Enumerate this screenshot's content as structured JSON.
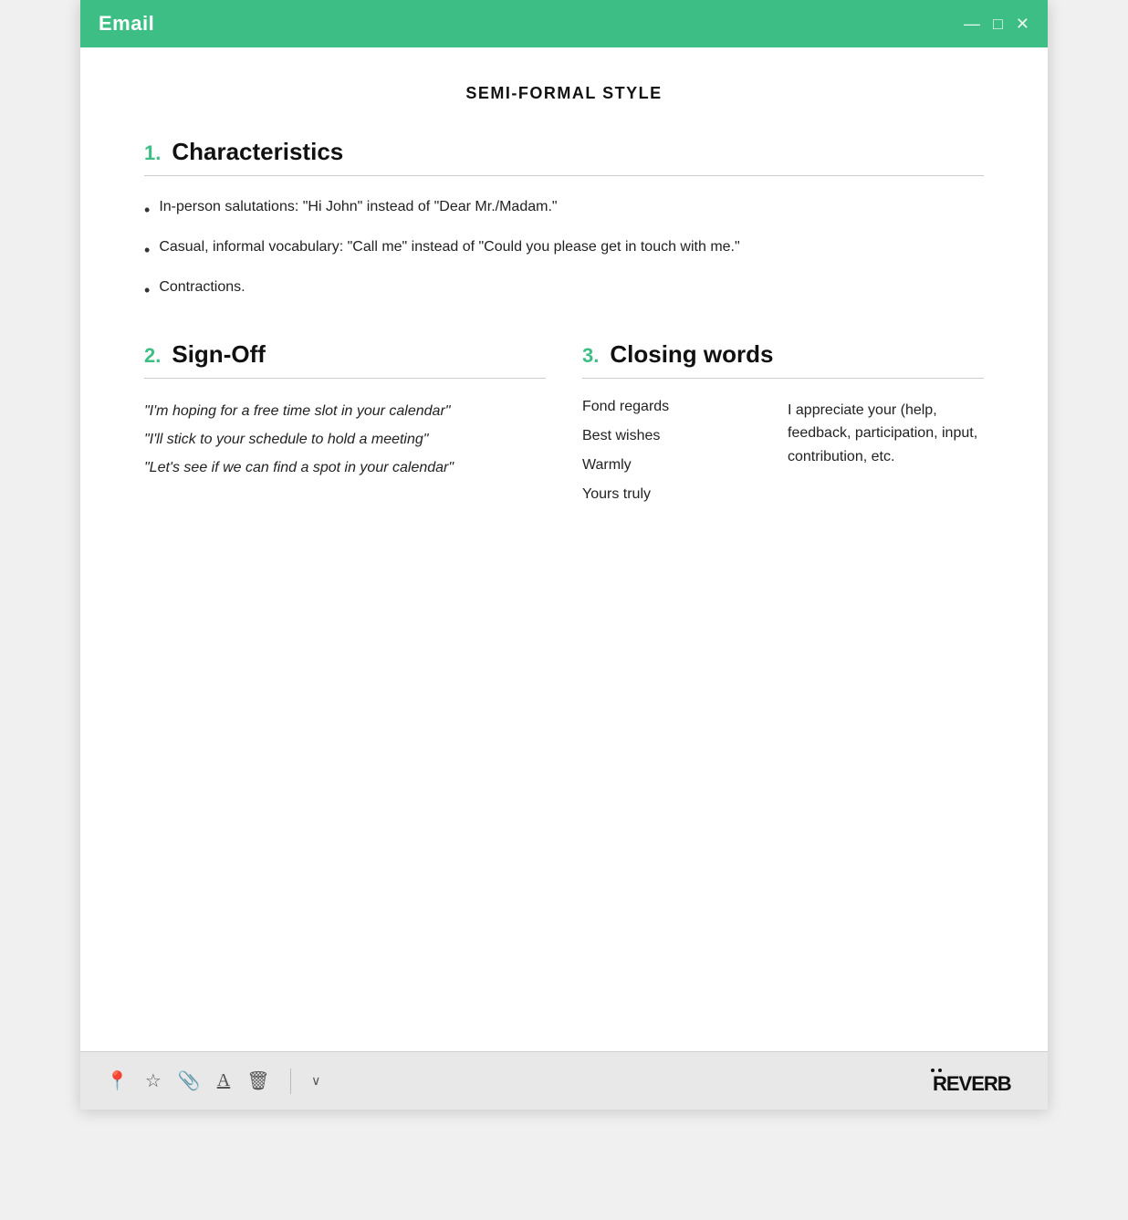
{
  "window": {
    "title": "Email",
    "controls": [
      "—",
      "□",
      "✕"
    ]
  },
  "main_title": "SEMI-FORMAL STYLE",
  "section1": {
    "number": "1.",
    "title": "Characteristics",
    "bullets": [
      "In-person salutations: \"Hi John\" instead of \"Dear Mr./Madam.\"",
      "Casual, informal vocabulary: \"Call me\" instead of \"Could you please get in touch with me.\"",
      "Contractions."
    ]
  },
  "section2": {
    "number": "2.",
    "title": "Sign-Off",
    "items": [
      "\"I'm hoping for a free time slot in your calendar\"",
      "\"I'll stick to your schedule to hold a meeting\"",
      "\"Let's see if we can find a spot in your calendar\""
    ]
  },
  "section3": {
    "number": "3.",
    "title": "Closing words",
    "closing_words": [
      "Fond regards",
      "Best wishes",
      "Warmly",
      "Yours truly"
    ],
    "closing_desc": "I appreciate your (help, feedback, participation, input, contribution, etc."
  },
  "footer": {
    "icons": [
      "📍",
      "☆",
      "📎",
      "A",
      "🗑"
    ],
    "dropdown_label": "∨",
    "logo": "REVERB"
  }
}
